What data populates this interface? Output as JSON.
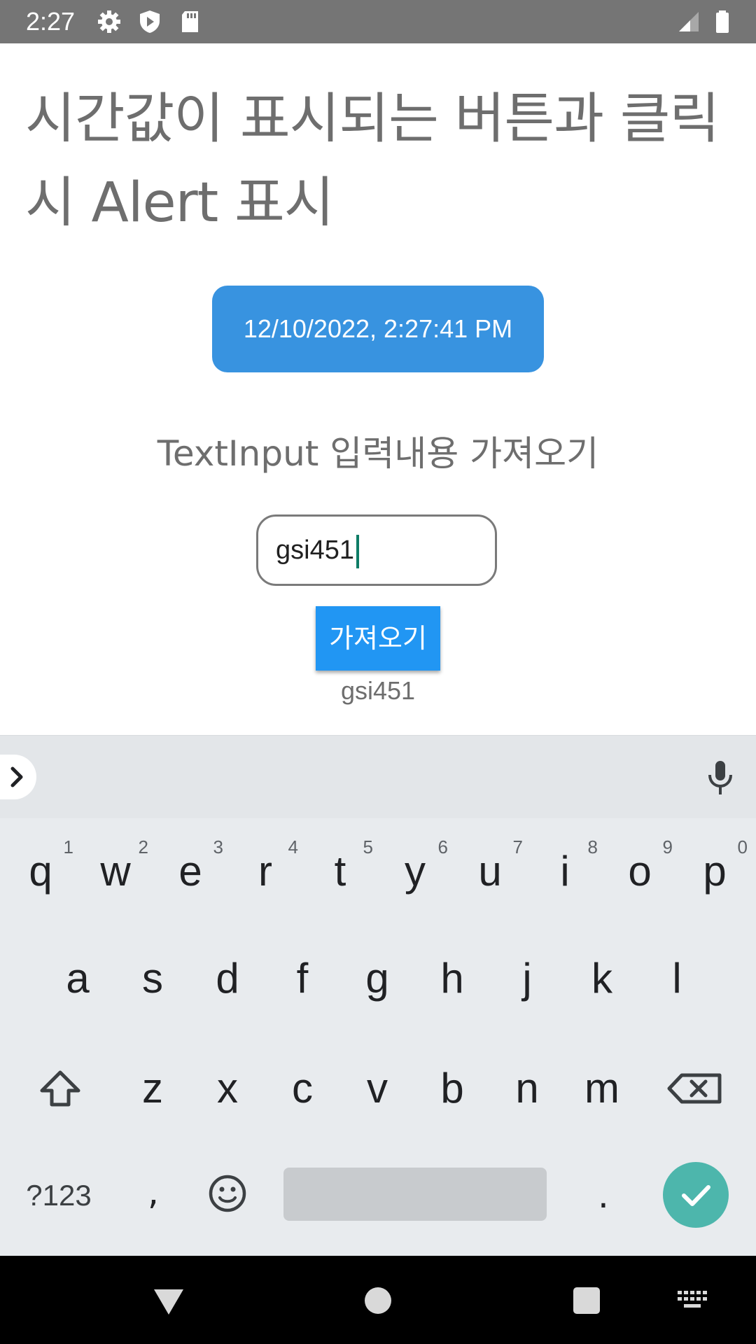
{
  "status_bar": {
    "time": "2:27",
    "icons": [
      "settings-icon",
      "shield-play-icon",
      "sd-card-icon",
      "signal-icon",
      "battery-icon"
    ]
  },
  "main": {
    "title": "시간값이 표시되는 버튼과 클릭 시 Alert 표시",
    "time_button_label": "12/10/2022, 2:27:41 PM",
    "section_label": "TextInput 입력내용 가져오기",
    "input_value": "gsi451",
    "fetch_button_label": "가져오기",
    "result_text": "gsi451"
  },
  "keyboard": {
    "row1": [
      {
        "key": "q",
        "hint": "1"
      },
      {
        "key": "w",
        "hint": "2"
      },
      {
        "key": "e",
        "hint": "3"
      },
      {
        "key": "r",
        "hint": "4"
      },
      {
        "key": "t",
        "hint": "5"
      },
      {
        "key": "y",
        "hint": "6"
      },
      {
        "key": "u",
        "hint": "7"
      },
      {
        "key": "i",
        "hint": "8"
      },
      {
        "key": "o",
        "hint": "9"
      },
      {
        "key": "p",
        "hint": "0"
      }
    ],
    "row2": [
      "a",
      "s",
      "d",
      "f",
      "g",
      "h",
      "j",
      "k",
      "l"
    ],
    "row3": [
      "z",
      "x",
      "c",
      "v",
      "b",
      "n",
      "m"
    ],
    "symbols_label": "?123",
    "comma_label": ",",
    "period_label": "."
  },
  "colors": {
    "primary_button": "#3893e0",
    "fetch_button": "#2196f3",
    "enter_key": "#4db6ac",
    "status_bar": "#757575"
  }
}
